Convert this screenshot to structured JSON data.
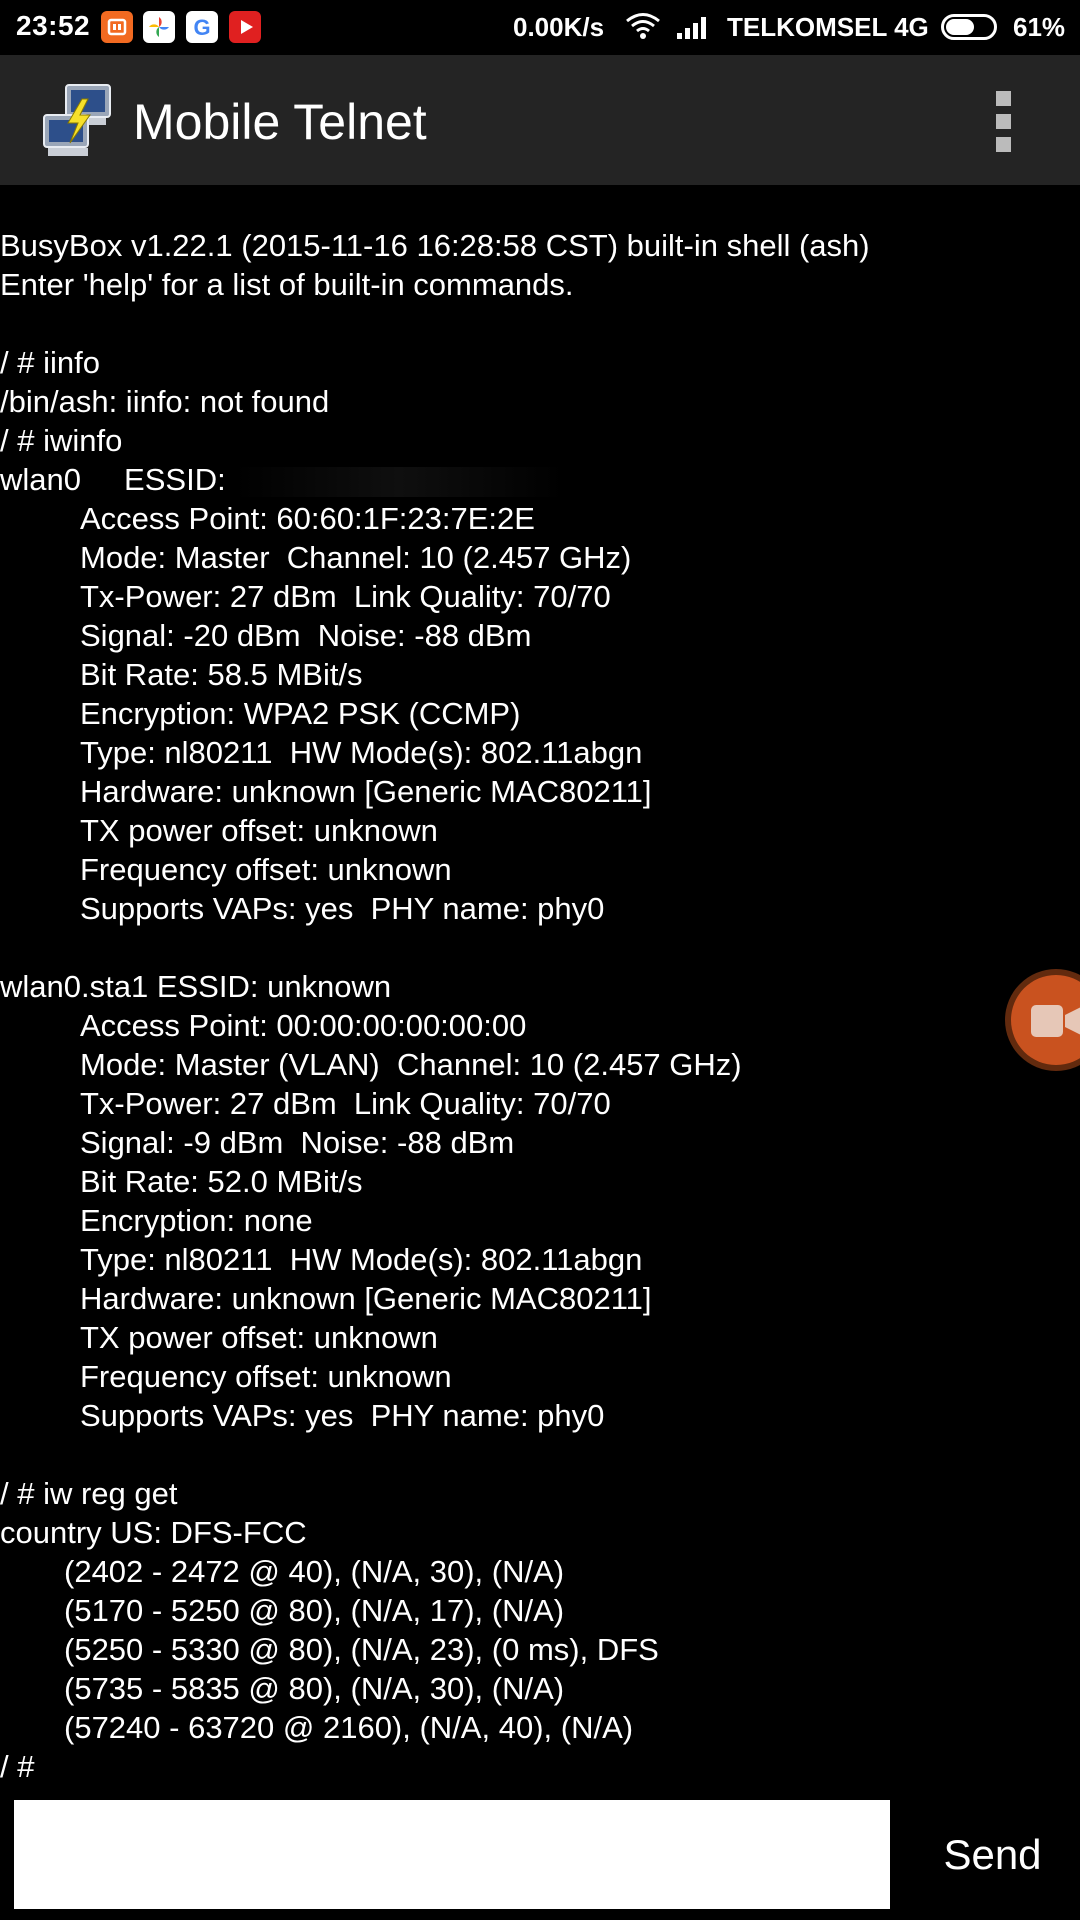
{
  "status_bar": {
    "time": "23:52",
    "notification_icons": [
      "mi-icon",
      "google-photos-icon",
      "google-icon",
      "youtube-icon"
    ],
    "net_speed": "0.00K/s",
    "carrier": "TELKOMSEL 4G",
    "battery_percent": "61%",
    "battery_level": 0.61
  },
  "app_bar": {
    "title": "Mobile Telnet",
    "icon": "network-computers-icon",
    "menu_icon": "overflow-menu-icon"
  },
  "terminal": {
    "lines": [
      {
        "text": "BusyBox v1.22.1 (2015-11-16 16:28:58 CST) built-in shell (ash)",
        "indent": 0
      },
      {
        "text": "Enter 'help' for a list of built-in commands.",
        "indent": 0
      },
      {
        "text": "",
        "indent": 0
      },
      {
        "text": "/ # iinfo",
        "indent": 0
      },
      {
        "text": "/bin/ash: iinfo: not found",
        "indent": 0
      },
      {
        "text": "/ # iwinfo",
        "indent": 0
      },
      {
        "text": "wlan0     ESSID: ",
        "indent": 0,
        "redacted": true
      },
      {
        "text": "Access Point: 60:60:1F:23:7E:2E",
        "indent": 1
      },
      {
        "text": "Mode: Master  Channel: 10 (2.457 GHz)",
        "indent": 1
      },
      {
        "text": "Tx-Power: 27 dBm  Link Quality: 70/70",
        "indent": 1
      },
      {
        "text": "Signal: -20 dBm  Noise: -88 dBm",
        "indent": 1
      },
      {
        "text": "Bit Rate: 58.5 MBit/s",
        "indent": 1
      },
      {
        "text": "Encryption: WPA2 PSK (CCMP)",
        "indent": 1
      },
      {
        "text": "Type: nl80211  HW Mode(s): 802.11abgn",
        "indent": 1
      },
      {
        "text": "Hardware: unknown [Generic MAC80211]",
        "indent": 1
      },
      {
        "text": "TX power offset: unknown",
        "indent": 1
      },
      {
        "text": "Frequency offset: unknown",
        "indent": 1
      },
      {
        "text": "Supports VAPs: yes  PHY name: phy0",
        "indent": 1
      },
      {
        "text": "",
        "indent": 0
      },
      {
        "text": "wlan0.sta1 ESSID: unknown",
        "indent": 0
      },
      {
        "text": "Access Point: 00:00:00:00:00:00",
        "indent": 1
      },
      {
        "text": "Mode: Master (VLAN)  Channel: 10 (2.457 GHz)",
        "indent": 1
      },
      {
        "text": "Tx-Power: 27 dBm  Link Quality: 70/70",
        "indent": 1
      },
      {
        "text": "Signal: -9 dBm  Noise: -88 dBm",
        "indent": 1
      },
      {
        "text": "Bit Rate: 52.0 MBit/s",
        "indent": 1
      },
      {
        "text": "Encryption: none",
        "indent": 1
      },
      {
        "text": "Type: nl80211  HW Mode(s): 802.11abgn",
        "indent": 1
      },
      {
        "text": "Hardware: unknown [Generic MAC80211]",
        "indent": 1
      },
      {
        "text": "TX power offset: unknown",
        "indent": 1
      },
      {
        "text": "Frequency offset: unknown",
        "indent": 1
      },
      {
        "text": "Supports VAPs: yes  PHY name: phy0",
        "indent": 1
      },
      {
        "text": "",
        "indent": 0
      },
      {
        "text": "/ # iw reg get",
        "indent": 0
      },
      {
        "text": "country US: DFS-FCC",
        "indent": 0
      },
      {
        "text": "(2402 - 2472 @ 40), (N/A, 30), (N/A)",
        "indent": 2
      },
      {
        "text": "(5170 - 5250 @ 80), (N/A, 17), (N/A)",
        "indent": 2
      },
      {
        "text": "(5250 - 5330 @ 80), (N/A, 23), (0 ms), DFS",
        "indent": 2
      },
      {
        "text": "(5735 - 5835 @ 80), (N/A, 30), (N/A)",
        "indent": 2
      },
      {
        "text": "(57240 - 63720 @ 2160), (N/A, 40), (N/A)",
        "indent": 2
      },
      {
        "text": "/ #",
        "indent": 0
      }
    ]
  },
  "floating_button": {
    "icon": "video-camera-icon",
    "color": "#c9521f"
  },
  "input_bar": {
    "value": "",
    "send_label": "Send"
  },
  "colors": {
    "background": "#000000",
    "app_bar": "#242424",
    "text": "#ffffff"
  }
}
